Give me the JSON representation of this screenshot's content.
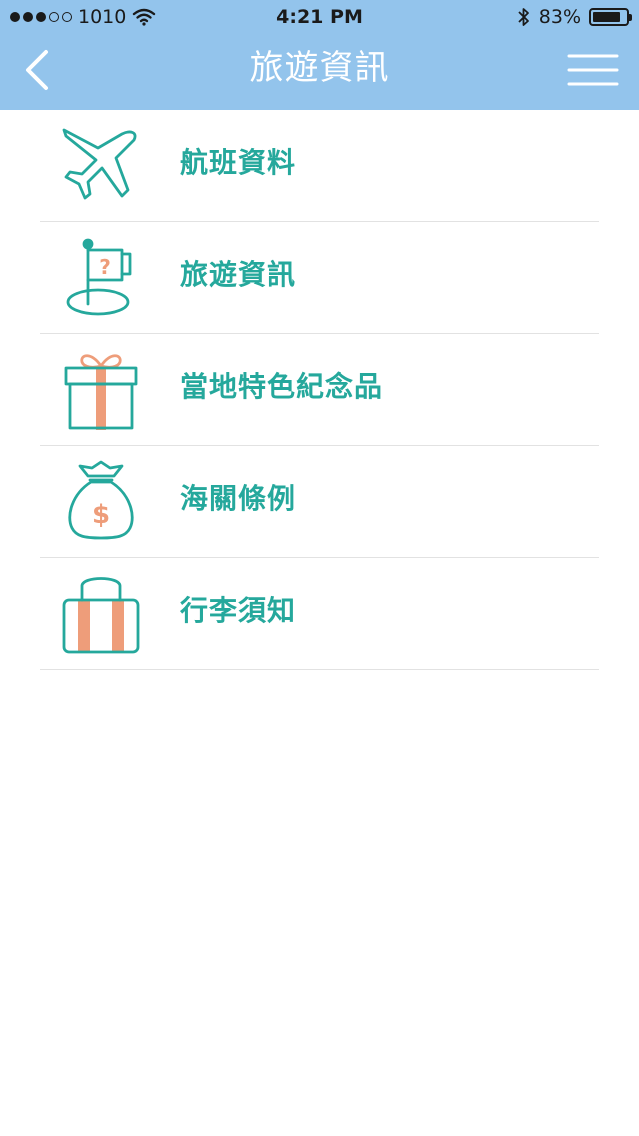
{
  "status_bar": {
    "carrier": "1010",
    "time": "4:21 PM",
    "battery_percent_text": "83%",
    "battery_level": 0.83,
    "signal_filled": 3,
    "signal_total": 5
  },
  "nav": {
    "title": "旅遊資訊",
    "back_icon": "chevron-left-icon",
    "menu_icon": "hamburger-menu-icon"
  },
  "colors": {
    "header_bg": "#93c4ec",
    "accent_teal": "#25a89c",
    "accent_salmon": "#ee9d7a",
    "divider": "#e2e2e2"
  },
  "menu_items": [
    {
      "label": "航班資料",
      "icon": "airplane-icon"
    },
    {
      "label": "旅遊資訊",
      "icon": "flag-question-icon"
    },
    {
      "label": "當地特色紀念品",
      "icon": "gift-box-icon"
    },
    {
      "label": "海關條例",
      "icon": "money-bag-icon"
    },
    {
      "label": "行李須知",
      "icon": "luggage-icon"
    }
  ]
}
